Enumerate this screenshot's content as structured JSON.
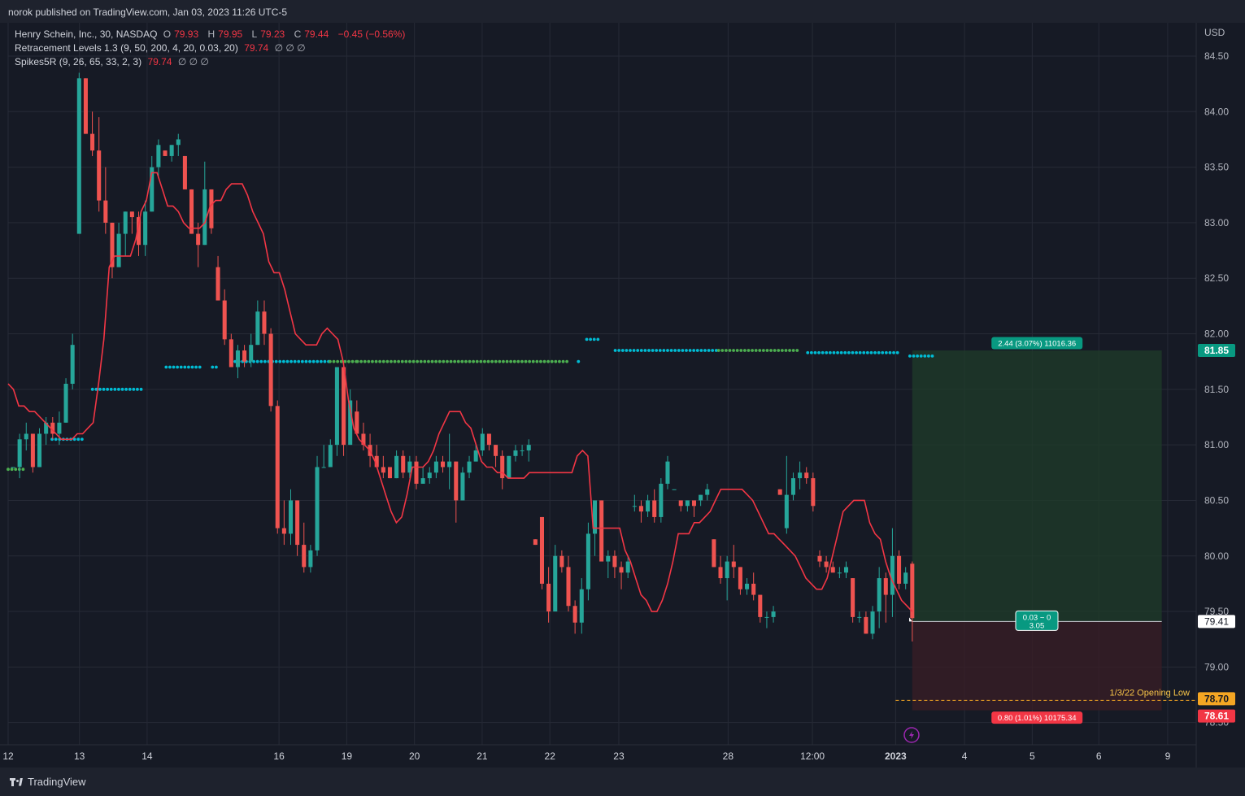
{
  "publish_line": "norok published on TradingView.com, Jan 03, 2023 11:26 UTC-5",
  "legend": {
    "symbol": "Henry Schein, Inc., 30, NASDAQ",
    "o_label": "O",
    "o": "79.93",
    "h_label": "H",
    "h": "79.95",
    "l_label": "L",
    "l": "79.23",
    "c_label": "C",
    "c": "79.44",
    "change": "−0.45 (−0.56%)",
    "ind1_name": "Retracement Levels 1.3 (9, 50, 200, 4, 20, 0.03, 20)",
    "ind1_value": "79.74",
    "ind1_extra": "∅ ∅ ∅",
    "ind2_name": "Spikes5R (9, 26, 65, 33, 2, 3)",
    "ind2_value": "79.74",
    "ind2_extra": "∅ ∅ ∅"
  },
  "currency": "USD",
  "brand": "TradingView",
  "colors": {
    "up": "#26a69a",
    "down": "#ef5350",
    "line": "#f23645",
    "dot_cyan": "#00bcd4",
    "dot_green": "#4caf50",
    "profit_zone": "#1f3c2a",
    "loss_zone": "#3a1e25"
  },
  "chart_data": {
    "type": "candlestick",
    "y_axis": {
      "min": 78.3,
      "max": 84.8,
      "ticks": [
        "84.50",
        "84.00",
        "83.50",
        "83.00",
        "82.50",
        "82.00",
        "81.50",
        "81.00",
        "80.50",
        "80.00",
        "79.50",
        "79.00",
        "78.50"
      ]
    },
    "x_axis": {
      "ticks": [
        "12",
        "13",
        "14",
        "16",
        "19",
        "20",
        "21",
        "22",
        "23",
        "28",
        "12:00",
        "2023",
        "4",
        "5",
        "6",
        "9"
      ]
    },
    "candles": [
      [
        80.8,
        80.8,
        80.8,
        80.8
      ],
      [
        80.8,
        81.1,
        80.7,
        81.05
      ],
      [
        81.05,
        81.2,
        80.95,
        81.1
      ],
      [
        81.1,
        81.1,
        80.75,
        80.8
      ],
      [
        80.8,
        81.15,
        80.8,
        81.1
      ],
      [
        81.1,
        81.25,
        81.0,
        81.2
      ],
      [
        81.2,
        81.25,
        81.05,
        81.1
      ],
      [
        81.1,
        81.3,
        81.0,
        81.2
      ],
      [
        81.2,
        81.6,
        81.2,
        81.55
      ],
      [
        81.55,
        82.0,
        81.5,
        81.9
      ],
      [
        82.9,
        84.35,
        82.9,
        84.3
      ],
      [
        84.3,
        84.3,
        83.8,
        83.8
      ],
      [
        83.8,
        84.0,
        83.6,
        83.65
      ],
      [
        83.65,
        83.95,
        83.1,
        83.2
      ],
      [
        83.2,
        83.5,
        82.9,
        83.0
      ],
      [
        83.0,
        83.0,
        82.5,
        82.6
      ],
      [
        82.6,
        83.0,
        82.6,
        82.9
      ],
      [
        82.9,
        83.1,
        82.7,
        83.1
      ],
      [
        83.1,
        83.1,
        82.9,
        83.05
      ],
      [
        83.05,
        83.1,
        82.7,
        82.8
      ],
      [
        82.8,
        83.2,
        82.7,
        83.1
      ],
      [
        83.1,
        83.6,
        83.1,
        83.5
      ],
      [
        83.5,
        83.75,
        83.4,
        83.7
      ],
      [
        83.65,
        83.65,
        83.6,
        83.6
      ],
      [
        83.6,
        83.7,
        83.55,
        83.7
      ],
      [
        83.7,
        83.8,
        83.6,
        83.75
      ],
      [
        83.6,
        83.6,
        83.3,
        83.3
      ],
      [
        83.3,
        83.3,
        82.9,
        82.9
      ],
      [
        82.9,
        83.0,
        82.6,
        82.8
      ],
      [
        82.8,
        83.55,
        82.8,
        83.3
      ],
      [
        83.3,
        83.3,
        82.9,
        82.95
      ],
      [
        82.6,
        82.7,
        82.3,
        82.3
      ],
      [
        82.3,
        82.4,
        81.9,
        81.95
      ],
      [
        81.95,
        82.0,
        81.7,
        81.7
      ],
      [
        81.7,
        81.9,
        81.6,
        81.85
      ],
      [
        81.85,
        81.9,
        81.7,
        81.75
      ],
      [
        81.75,
        82.0,
        81.7,
        81.9
      ],
      [
        81.9,
        82.3,
        81.9,
        82.2
      ],
      [
        82.2,
        82.3,
        81.9,
        82.0
      ],
      [
        82.0,
        82.05,
        81.3,
        81.35
      ],
      [
        81.35,
        81.4,
        80.2,
        80.25
      ],
      [
        80.25,
        80.5,
        80.1,
        80.2
      ],
      [
        80.2,
        80.6,
        80.1,
        80.5
      ],
      [
        80.5,
        80.5,
        80.0,
        80.1
      ],
      [
        80.1,
        80.3,
        79.85,
        79.9
      ],
      [
        79.9,
        80.1,
        79.85,
        80.05
      ],
      [
        80.05,
        80.9,
        80.0,
        80.8
      ],
      [
        80.8,
        81.0,
        80.8,
        80.8
      ],
      [
        80.8,
        81.05,
        80.8,
        81.0
      ],
      [
        81.0,
        81.7,
        80.9,
        81.7
      ],
      [
        81.7,
        81.75,
        80.9,
        81.0
      ],
      [
        81.0,
        81.5,
        81.0,
        81.4
      ],
      [
        81.3,
        81.4,
        81.1,
        81.1
      ],
      [
        81.1,
        81.2,
        80.95,
        81.0
      ],
      [
        81.0,
        81.1,
        80.8,
        80.9
      ],
      [
        80.9,
        81.0,
        80.8,
        80.8
      ],
      [
        80.8,
        80.9,
        80.7,
        80.75
      ],
      [
        80.8,
        80.8,
        80.7,
        80.7
      ],
      [
        80.7,
        80.95,
        80.7,
        80.9
      ],
      [
        80.9,
        80.95,
        80.7,
        80.75
      ],
      [
        80.75,
        80.9,
        80.7,
        80.85
      ],
      [
        80.85,
        80.9,
        80.6,
        80.65
      ],
      [
        80.65,
        80.8,
        80.65,
        80.7
      ],
      [
        80.7,
        80.8,
        80.65,
        80.75
      ],
      [
        80.75,
        80.9,
        80.7,
        80.85
      ],
      [
        80.85,
        80.9,
        80.75,
        80.8
      ],
      [
        80.8,
        81.1,
        80.6,
        80.85
      ],
      [
        80.85,
        80.85,
        80.3,
        80.5
      ],
      [
        80.5,
        80.8,
        80.5,
        80.75
      ],
      [
        80.75,
        80.9,
        80.7,
        80.85
      ],
      [
        80.85,
        81.0,
        80.85,
        80.95
      ],
      [
        80.95,
        81.15,
        80.9,
        81.1
      ],
      [
        81.1,
        81.1,
        80.95,
        81.0
      ],
      [
        81.0,
        81.0,
        80.8,
        80.9
      ],
      [
        80.9,
        80.95,
        80.6,
        80.7
      ],
      [
        80.7,
        80.9,
        80.7,
        80.9
      ],
      [
        80.9,
        81.0,
        80.85,
        80.95
      ],
      [
        80.95,
        81.0,
        80.9,
        80.95
      ],
      [
        80.95,
        81.05,
        80.85,
        81.0
      ],
      [
        80.15,
        80.15,
        80.1,
        80.1
      ],
      [
        80.35,
        80.35,
        79.7,
        79.75
      ],
      [
        79.75,
        79.9,
        79.4,
        79.5
      ],
      [
        79.5,
        80.1,
        79.5,
        80.0
      ],
      [
        80.0,
        80.05,
        79.85,
        79.9
      ],
      [
        79.9,
        80.0,
        79.5,
        79.55
      ],
      [
        79.55,
        79.6,
        79.3,
        79.4
      ],
      [
        79.4,
        79.8,
        79.3,
        79.7
      ],
      [
        79.7,
        80.3,
        79.6,
        80.2
      ],
      [
        80.2,
        80.5,
        80.0,
        80.5
      ],
      [
        80.5,
        80.5,
        80.0,
        79.95
      ],
      [
        79.95,
        80.05,
        79.8,
        80.0
      ],
      [
        80.0,
        80.05,
        79.8,
        79.9
      ],
      [
        79.9,
        79.95,
        79.7,
        79.85
      ],
      [
        79.85,
        80.0,
        79.8,
        79.95
      ],
      [
        80.45,
        80.55,
        80.4,
        80.45
      ],
      [
        80.45,
        80.5,
        80.3,
        80.4
      ],
      [
        80.4,
        80.55,
        80.35,
        80.5
      ],
      [
        80.5,
        80.6,
        80.3,
        80.35
      ],
      [
        80.35,
        80.7,
        80.3,
        80.65
      ],
      [
        80.65,
        80.9,
        80.6,
        80.85
      ],
      [
        80.6,
        80.6,
        80.6,
        80.6
      ],
      [
        80.5,
        80.5,
        80.4,
        80.45
      ],
      [
        80.45,
        80.5,
        80.4,
        80.5
      ],
      [
        80.5,
        80.5,
        80.35,
        80.45
      ],
      [
        80.5,
        80.55,
        80.45,
        80.55
      ],
      [
        80.55,
        80.65,
        80.5,
        80.6
      ],
      [
        80.15,
        80.15,
        79.9,
        79.9
      ],
      [
        79.9,
        80.0,
        79.75,
        79.8
      ],
      [
        79.8,
        80.0,
        79.6,
        79.95
      ],
      [
        79.95,
        80.1,
        79.8,
        79.9
      ],
      [
        79.9,
        79.9,
        79.65,
        79.7
      ],
      [
        79.7,
        79.8,
        79.65,
        79.75
      ],
      [
        79.75,
        79.85,
        79.6,
        79.65
      ],
      [
        79.65,
        79.65,
        79.4,
        79.45
      ],
      [
        79.45,
        79.5,
        79.35,
        79.45
      ],
      [
        79.45,
        79.55,
        79.4,
        79.5
      ],
      [
        80.6,
        80.6,
        80.55,
        80.55
      ],
      [
        80.25,
        80.9,
        80.2,
        80.55
      ],
      [
        80.55,
        80.75,
        80.5,
        80.7
      ],
      [
        80.7,
        80.85,
        80.6,
        80.75
      ],
      [
        80.75,
        80.8,
        80.65,
        80.7
      ],
      [
        80.7,
        80.75,
        80.4,
        80.45
      ],
      [
        80.0,
        80.05,
        79.9,
        79.95
      ],
      [
        79.95,
        80.0,
        79.85,
        79.9
      ],
      [
        79.9,
        79.95,
        79.85,
        79.85
      ],
      [
        79.85,
        79.9,
        79.8,
        79.85
      ],
      [
        79.85,
        79.95,
        79.8,
        79.9
      ],
      [
        79.8,
        79.8,
        79.4,
        79.45
      ],
      [
        79.45,
        79.5,
        79.4,
        79.45
      ],
      [
        79.45,
        79.5,
        79.3,
        79.3
      ],
      [
        79.3,
        79.55,
        79.25,
        79.5
      ],
      [
        79.5,
        79.9,
        79.35,
        79.8
      ],
      [
        79.8,
        79.85,
        79.4,
        79.65
      ],
      [
        79.65,
        80.25,
        79.45,
        80.0
      ],
      [
        80.0,
        80.05,
        79.7,
        79.75
      ],
      [
        79.75,
        79.9,
        79.7,
        79.85
      ],
      [
        79.93,
        79.95,
        79.23,
        79.44
      ]
    ],
    "line": [
      81.55,
      81.5,
      81.35,
      81.35,
      81.3,
      81.3,
      81.25,
      81.2,
      81.15,
      81.1,
      81.05,
      81.05,
      81.05,
      81.1,
      81.1,
      81.15,
      81.2,
      81.55,
      81.95,
      82.6,
      82.7,
      82.7,
      82.7,
      82.7,
      82.85,
      83.1,
      83.2,
      83.45,
      83.45,
      83.3,
      83.15,
      83.15,
      83.1,
      83.0,
      82.95,
      82.95,
      82.95,
      83.0,
      83.15,
      83.2,
      83.2,
      83.3,
      83.35,
      83.35,
      83.35,
      83.25,
      83.1,
      83.0,
      82.9,
      82.65,
      82.55,
      82.55,
      82.4,
      82.2,
      82.0,
      81.95,
      81.9,
      81.9,
      81.9,
      82.0,
      82.05,
      82.0,
      81.95,
      81.75,
      81.4,
      81.15,
      81.05,
      81.0,
      80.95,
      80.85,
      80.7,
      80.55,
      80.4,
      80.3,
      80.35,
      80.55,
      80.8,
      80.8,
      80.8,
      80.85,
      80.95,
      81.1,
      81.2,
      81.3,
      81.3,
      81.3,
      81.2,
      81.15,
      81.0,
      80.85,
      80.8,
      80.8,
      80.75,
      80.75,
      80.7,
      80.7,
      80.7,
      80.7,
      80.75,
      80.75,
      80.75,
      80.75,
      80.75,
      80.75,
      80.75,
      80.75,
      80.75,
      80.9,
      80.95,
      80.9,
      80.25,
      80.25,
      80.25,
      80.25,
      80.25,
      80.25,
      80.05,
      79.95,
      79.8,
      79.65,
      79.6,
      79.5,
      79.5,
      79.6,
      79.75,
      79.95,
      80.2,
      80.2,
      80.2,
      80.3,
      80.3,
      80.35,
      80.4,
      80.5,
      80.6,
      80.6,
      80.6,
      80.6,
      80.6,
      80.55,
      80.5,
      80.4,
      80.3,
      80.2,
      80.2,
      80.15,
      80.1,
      80.05,
      80.0,
      79.9,
      79.8,
      79.75,
      79.7,
      79.7,
      79.8,
      80.0,
      80.2,
      80.4,
      80.45,
      80.5,
      80.5,
      80.5,
      80.3,
      80.2,
      80.15,
      79.95,
      79.8,
      79.7,
      79.6,
      79.55,
      79.5
    ],
    "dot_segments": [
      {
        "x0": 0.0,
        "x1": 0.014,
        "y": 80.78,
        "color": "green"
      },
      {
        "x0": 0.037,
        "x1": 0.063,
        "y": 81.05,
        "color": "cyan"
      },
      {
        "x0": 0.071,
        "x1": 0.112,
        "y": 81.5,
        "color": "cyan"
      },
      {
        "x0": 0.133,
        "x1": 0.164,
        "y": 81.7,
        "color": "cyan"
      },
      {
        "x0": 0.172,
        "x1": 0.178,
        "y": 81.7,
        "color": "cyan"
      },
      {
        "x0": 0.191,
        "x1": 0.271,
        "y": 81.75,
        "color": "cyan"
      },
      {
        "x0": 0.271,
        "x1": 0.294,
        "y": 81.75,
        "color": "green"
      },
      {
        "x0": 0.294,
        "x1": 0.473,
        "y": 81.75,
        "color": "green"
      },
      {
        "x0": 0.48,
        "x1": 0.48,
        "y": 81.75,
        "color": "cyan"
      },
      {
        "x0": 0.487,
        "x1": 0.498,
        "y": 81.95,
        "color": "cyan"
      },
      {
        "x0": 0.511,
        "x1": 0.598,
        "y": 81.85,
        "color": "cyan"
      },
      {
        "x0": 0.598,
        "x1": 0.665,
        "y": 81.85,
        "color": "green"
      },
      {
        "x0": 0.673,
        "x1": 0.751,
        "y": 81.83,
        "color": "cyan"
      },
      {
        "x0": 0.759,
        "x1": 0.778,
        "y": 81.8,
        "color": "cyan"
      }
    ],
    "position": {
      "entry": 79.41,
      "target": 81.85,
      "stop": 78.61,
      "target_label": "2.44 (3.07%) 11016.36",
      "stop_label": "0.80 (1.01%) 10175.34",
      "center_label_top": "0.03 ~ 0",
      "center_label_bottom": "3.05"
    },
    "level_line": {
      "value": 78.7,
      "label": "1/3/22 Opening Low"
    },
    "price_tags": [
      "81.85",
      "79.41",
      "78.70",
      "78.61"
    ]
  }
}
